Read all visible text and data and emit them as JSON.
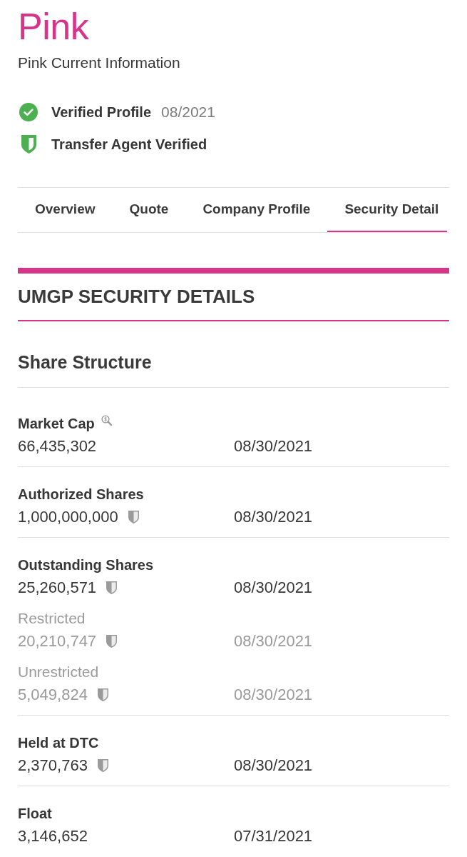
{
  "brand": {
    "logo": "Pink",
    "subtitle": "Pink Current Information"
  },
  "badges": [
    {
      "kind": "check",
      "label": "Verified Profile",
      "date": "08/2021"
    },
    {
      "kind": "shield",
      "label": "Transfer Agent Verified"
    }
  ],
  "tabs": [
    {
      "label": "Overview",
      "selected": false
    },
    {
      "label": "Quote",
      "selected": false
    },
    {
      "label": "Company Profile",
      "selected": false
    },
    {
      "label": "Security Detail",
      "selected": true
    }
  ],
  "security_details": {
    "title": "UMGP SECURITY DETAILS",
    "share_structure": {
      "title": "Share Structure",
      "rows": [
        {
          "label": "Market Cap",
          "lookup_icon": true,
          "value": "66,435,302",
          "shield": false,
          "date": "08/30/2021"
        },
        {
          "label": "Authorized Shares",
          "lookup_icon": false,
          "value": "1,000,000,000",
          "shield": true,
          "date": "08/30/2021"
        },
        {
          "label": "Outstanding Shares",
          "lookup_icon": false,
          "value": "25,260,571",
          "shield": true,
          "date": "08/30/2021",
          "breakdown": [
            {
              "label": "Restricted",
              "value": "20,210,747",
              "shield": true,
              "date": "08/30/2021"
            },
            {
              "label": "Unrestricted",
              "value": "5,049,824",
              "shield": true,
              "date": "08/30/2021"
            }
          ]
        },
        {
          "label": "Held at DTC",
          "lookup_icon": false,
          "value": "2,370,763",
          "shield": true,
          "date": "08/30/2021"
        },
        {
          "label": "Float",
          "lookup_icon": false,
          "value": "3,146,652",
          "shield": false,
          "date": "07/31/2021"
        }
      ]
    }
  }
}
